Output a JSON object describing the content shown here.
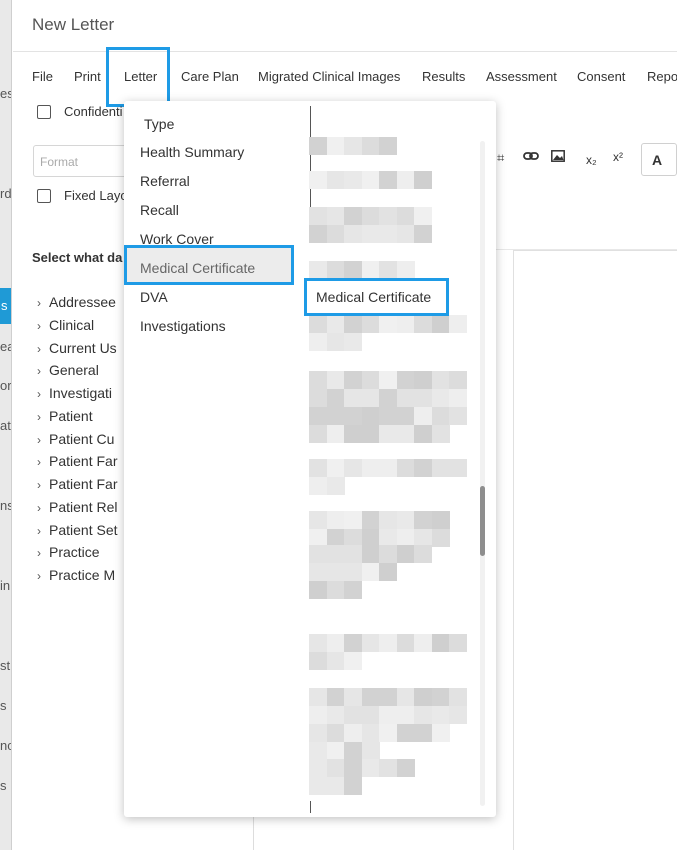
{
  "window": {
    "title": "New Letter"
  },
  "menu": [
    {
      "label": "File"
    },
    {
      "label": "Print"
    },
    {
      "label": "Letter"
    },
    {
      "label": "Care Plan"
    },
    {
      "label": "Migrated Clinical Images"
    },
    {
      "label": "Results"
    },
    {
      "label": "Assessment"
    },
    {
      "label": "Consent"
    },
    {
      "label": "Repo"
    }
  ],
  "options": {
    "confidential_label": "Confidenti",
    "fixed_layout_label": "Fixed Layo",
    "format_placeholder": "Format"
  },
  "toolbar": {
    "subscript": "x₂",
    "superscript": "x²",
    "bold": "A"
  },
  "left_panel": {
    "title": "Select what da",
    "tree": [
      "Addressee",
      "Clinical",
      "Current Us",
      "General",
      "Investigati",
      "Patient",
      "Patient Cu",
      "Patient Far",
      "Patient Far",
      "Patient Rel",
      "Patient Set",
      "Practice",
      "Practice M"
    ]
  },
  "edge_fragments": [
    "es",
    "rd",
    "s",
    "ea",
    "ory",
    "ati",
    "ns",
    "in",
    "sti",
    "s",
    "nc",
    "s"
  ],
  "dropdown": {
    "header": "Type",
    "items": [
      "Health Summary",
      "Referral",
      "Recall",
      "Work Cover",
      "Medical Certificate",
      "DVA",
      "Investigations"
    ],
    "selected": "Medical Certificate",
    "submenu_highlight": "Medical Certificate"
  }
}
